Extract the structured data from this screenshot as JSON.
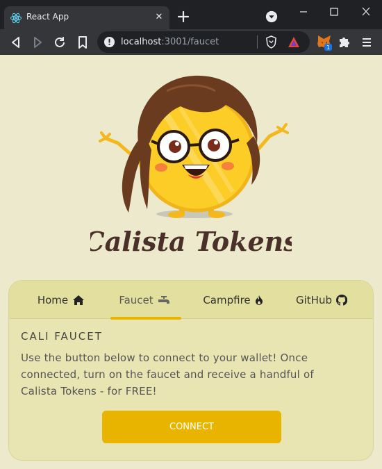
{
  "browser": {
    "tab_title": "React App",
    "tab_close": "✕",
    "url_host": "localhost",
    "url_rest": ":3001/faucet",
    "extension_badge": "1"
  },
  "logo": {
    "text": "Calista Tokens"
  },
  "nav": {
    "home": "Home",
    "faucet": "Faucet",
    "campfire": "Campfire",
    "github": "GitHub",
    "active": "faucet"
  },
  "faucet": {
    "title": "CALI FAUCET",
    "description": "Use the button below to connect to your wallet! Once connected, turn on the faucet and receive a handful of Calista Tokens - for FREE!",
    "connect_label": "CONNECT"
  },
  "colors": {
    "accent": "#e8b400",
    "page_bg": "#ece9cc",
    "card_bg": "#e8e5b2"
  }
}
